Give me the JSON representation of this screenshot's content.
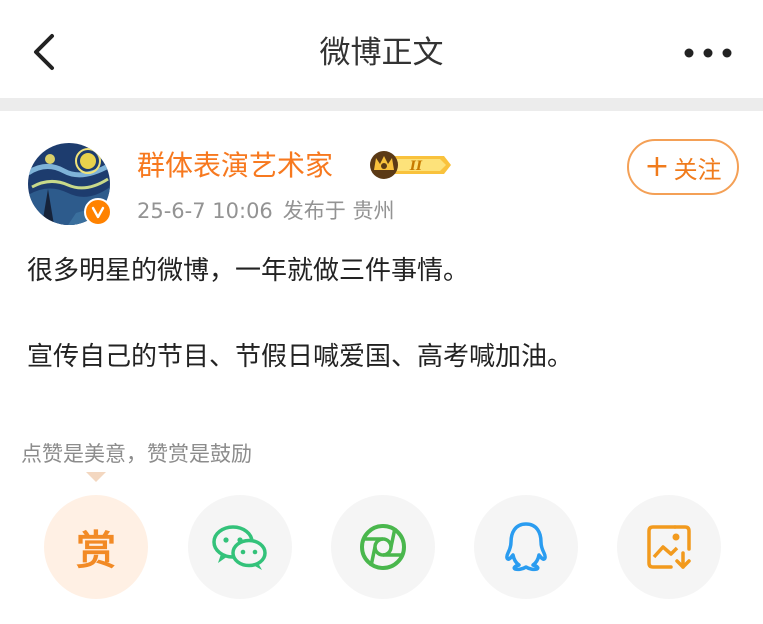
{
  "header": {
    "title": "微博正文"
  },
  "post": {
    "author": "群体表演艺术家",
    "timestamp": "25-6-7 10:06",
    "location": "发布于 贵州",
    "follow_label": "关注",
    "paragraphs": [
      "很多明星的微博，一年就做三件事情。",
      "宣传自己的节目、节假日喊爱国、高考喊加油。"
    ]
  },
  "reward": {
    "tip": "点赞是美意，赞赏是鼓励",
    "reward_char": "赏"
  },
  "share": {
    "icons": [
      "reward-icon",
      "wechat-icon",
      "moments-icon",
      "qq-icon",
      "save-image-icon"
    ]
  },
  "colors": {
    "accent": "#f7791f",
    "wechat": "#33c27a",
    "moments": "#4ab74d",
    "qq": "#2a9cf0",
    "save": "#f29a1d"
  }
}
